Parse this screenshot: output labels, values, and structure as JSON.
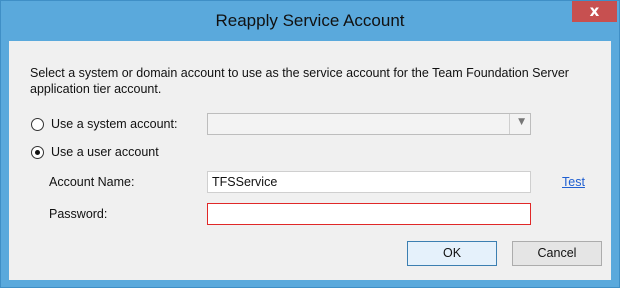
{
  "window": {
    "title": "Reapply Service Account",
    "close_glyph": "x"
  },
  "dialog": {
    "description": "Select a system or domain account to use as the service account for the Team Foundation Server application tier account.",
    "system_account": {
      "label": "Use a system account:",
      "selected": false,
      "dropdown_value": ""
    },
    "user_account": {
      "label": "Use a user account",
      "selected": true
    },
    "account_name": {
      "label": "Account Name:",
      "value": "TFSService"
    },
    "password": {
      "label": "Password:",
      "value": "",
      "invalid": true
    },
    "test_link": "Test",
    "ok_label": "OK",
    "cancel_label": "Cancel"
  },
  "colors": {
    "frame": "#5aa9dc",
    "close_button": "#c75050",
    "error_border": "#e02828",
    "link": "#1f5fd1"
  }
}
